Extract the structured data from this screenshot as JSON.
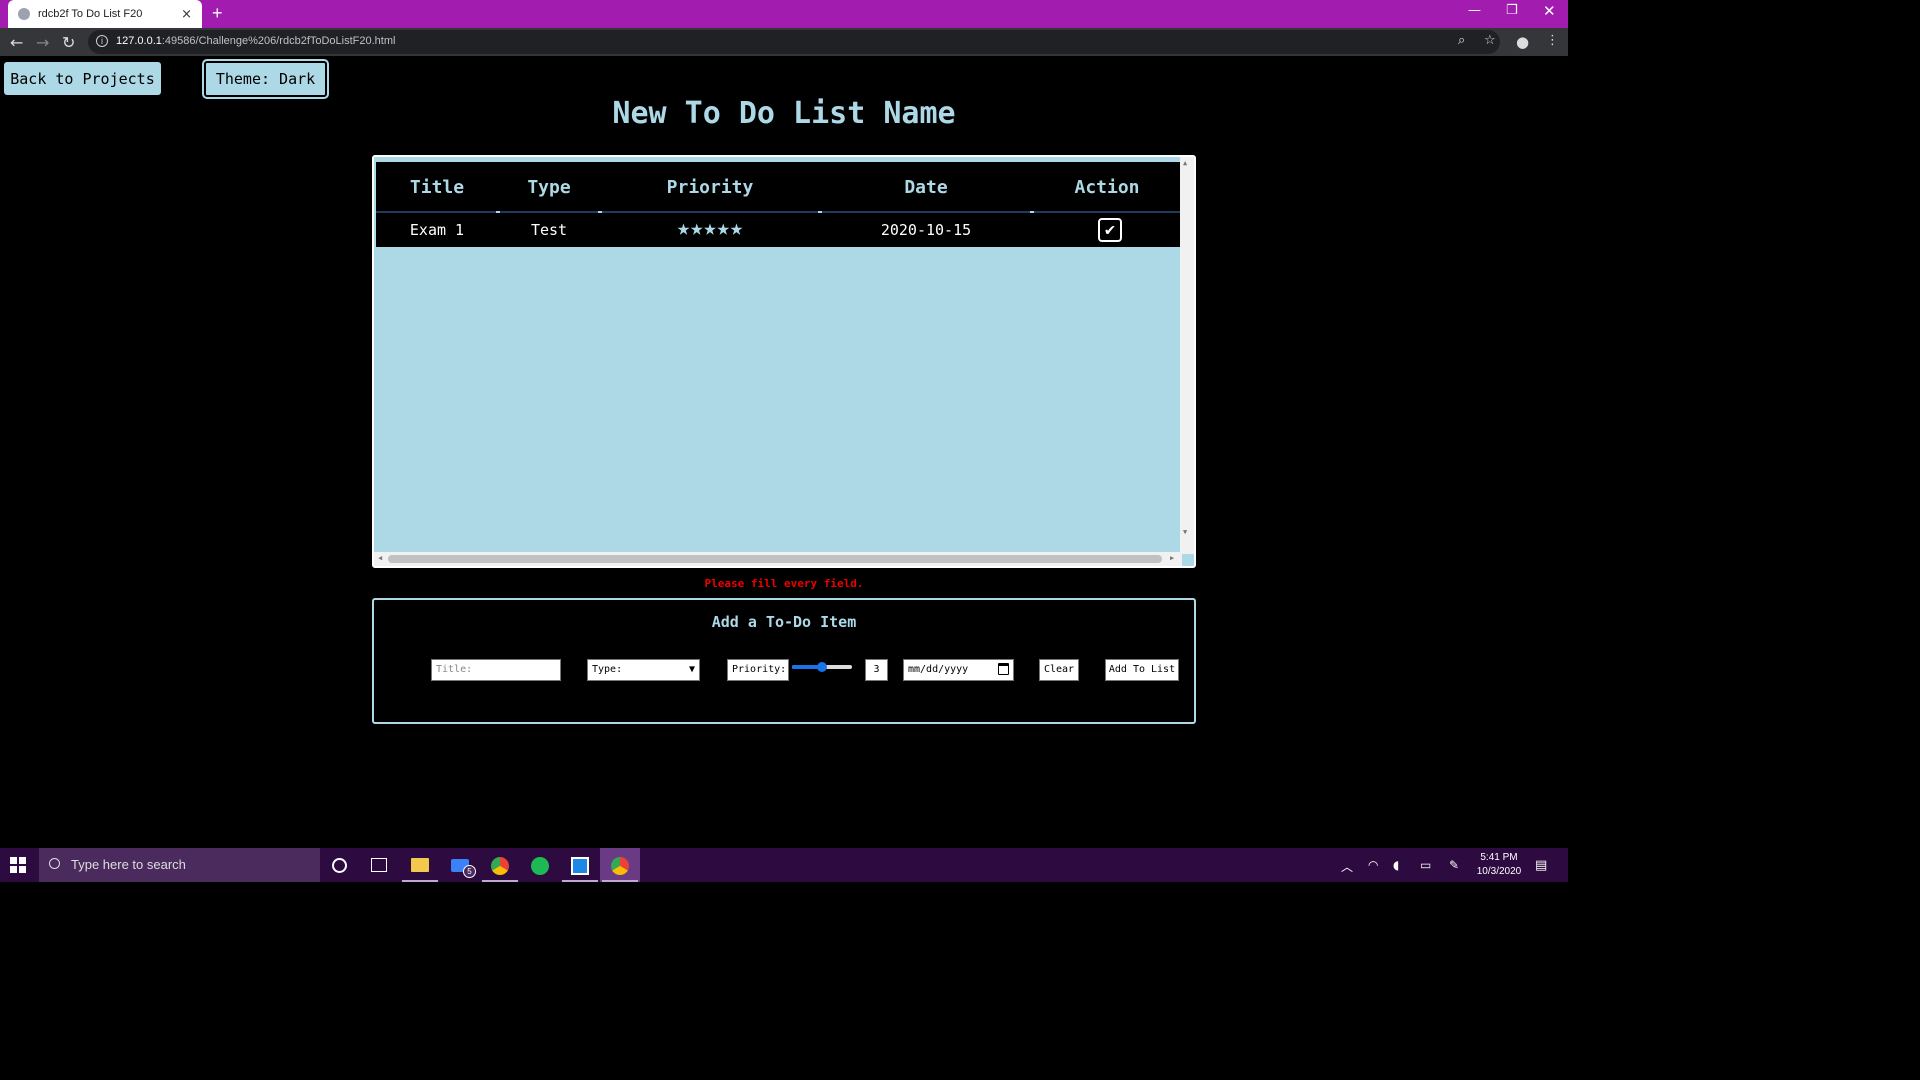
{
  "browser": {
    "tab_title": "rdcb2f To Do List F20",
    "tab_close": "×",
    "new_tab": "+",
    "url_host": "127.0.0.1",
    "url_rest": ":49586/Challenge%206/rdcb2fToDoListF20.html"
  },
  "header": {
    "back_label": "Back to Projects",
    "theme_label": "Theme: Dark",
    "title": "New To Do List Name"
  },
  "table": {
    "columns": [
      "Title",
      "Type",
      "Priority",
      "Date",
      "Action"
    ],
    "rows": [
      {
        "title": "Exam 1",
        "type": "Test",
        "priority_stars": "★★★★★",
        "priority": 5,
        "date": "2020-10-15",
        "action_checked": true
      }
    ]
  },
  "error_message": "Please fill every field.",
  "form": {
    "heading": "Add a To-Do Item",
    "title_placeholder": "Title:",
    "type_value": "Type:",
    "priority_label": "Priority:",
    "priority_value": "3",
    "priority_slider_fraction": 0.5,
    "date_placeholder": "mm/dd/yyyy",
    "clear_label": "Clear",
    "add_label": "Add To List"
  },
  "taskbar": {
    "search_placeholder": "Type here to search",
    "mail_badge": "5",
    "time": "5:41 PM",
    "date": "10/3/2020"
  },
  "colors": {
    "accent": "#add8e6",
    "browser_frame": "#a21caf",
    "error": "#ee0000",
    "taskbar": "#2d0a3f"
  }
}
